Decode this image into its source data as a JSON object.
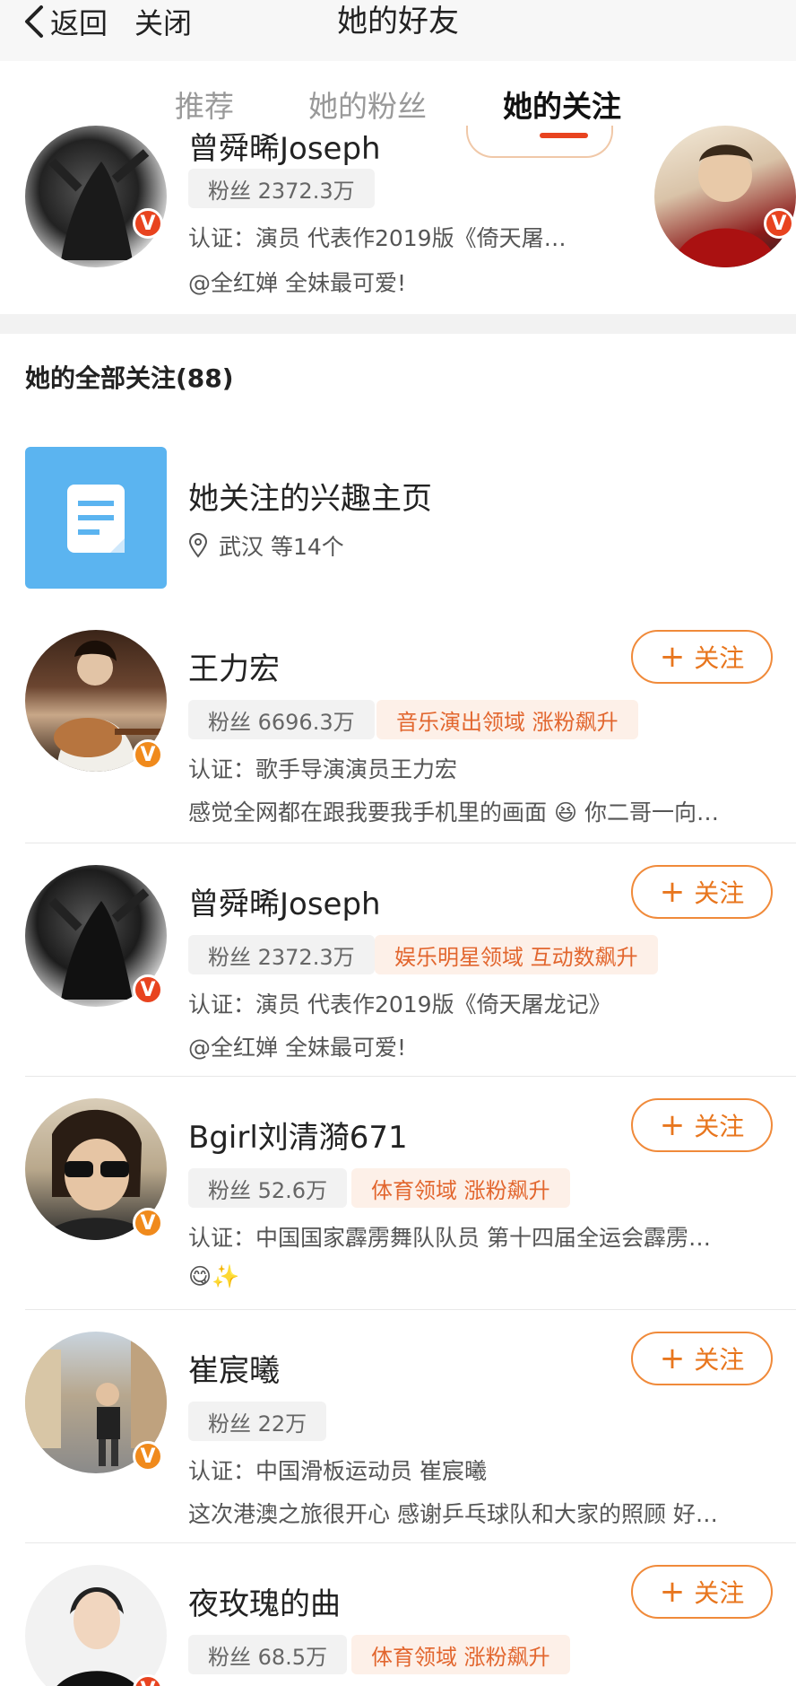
{
  "nav": {
    "back_label": "返回",
    "close_label": "关闭",
    "title": "她的好友"
  },
  "tabs": [
    {
      "label": "推荐"
    },
    {
      "label": "她的粉丝"
    },
    {
      "label": "她的关注"
    }
  ],
  "recommended_card": {
    "name_fragment": "曾舜晞Joseph",
    "fans": "粉丝 2372.3万",
    "verify": "认证：演员 代表作2019版《倚天屠…",
    "post": "@全红婵 全妹最可爱!"
  },
  "section_title": "她的全部关注(88)",
  "interest_page": {
    "title": "她关注的兴趣主页",
    "location": "武汉 等14个"
  },
  "follow_label": "关注",
  "users": [
    {
      "name": "王力宏",
      "fans": "粉丝 6696.3万",
      "tag": "音乐演出领域 涨粉飙升",
      "verify": "认证：歌手导演演员王力宏",
      "post": "感觉全网都在跟我要我手机里的画面 😆 你二哥一向…"
    },
    {
      "name": "曾舜晞Joseph",
      "fans": "粉丝 2372.3万",
      "tag": "娱乐明星领域 互动数飙升",
      "verify": "认证：演员 代表作2019版《倚天屠龙记》",
      "post": "@全红婵 全妹最可爱!"
    },
    {
      "name": "Bgirl刘清漪671",
      "fans": "粉丝 52.6万",
      "tag": "体育领域 涨粉飙升",
      "verify": "认证：中国国家霹雳舞队队员 第十四届全运会霹雳…",
      "post": "😋✨"
    },
    {
      "name": "崔宸曦",
      "fans": "粉丝 22万",
      "tag": "",
      "verify": "认证：中国滑板运动员 崔宸曦",
      "post": "这次港澳之旅很开心 感谢乒乓球队和大家的照顾 好…"
    },
    {
      "name": "夜玫瑰的曲",
      "fans": "粉丝 68.5万",
      "tag": "体育领域 涨粉飙升",
      "verify": "",
      "post": ""
    }
  ],
  "colors": {
    "accent": "#e8431f",
    "follow": "#e8761e",
    "badge_orange": "#f08a1c"
  }
}
